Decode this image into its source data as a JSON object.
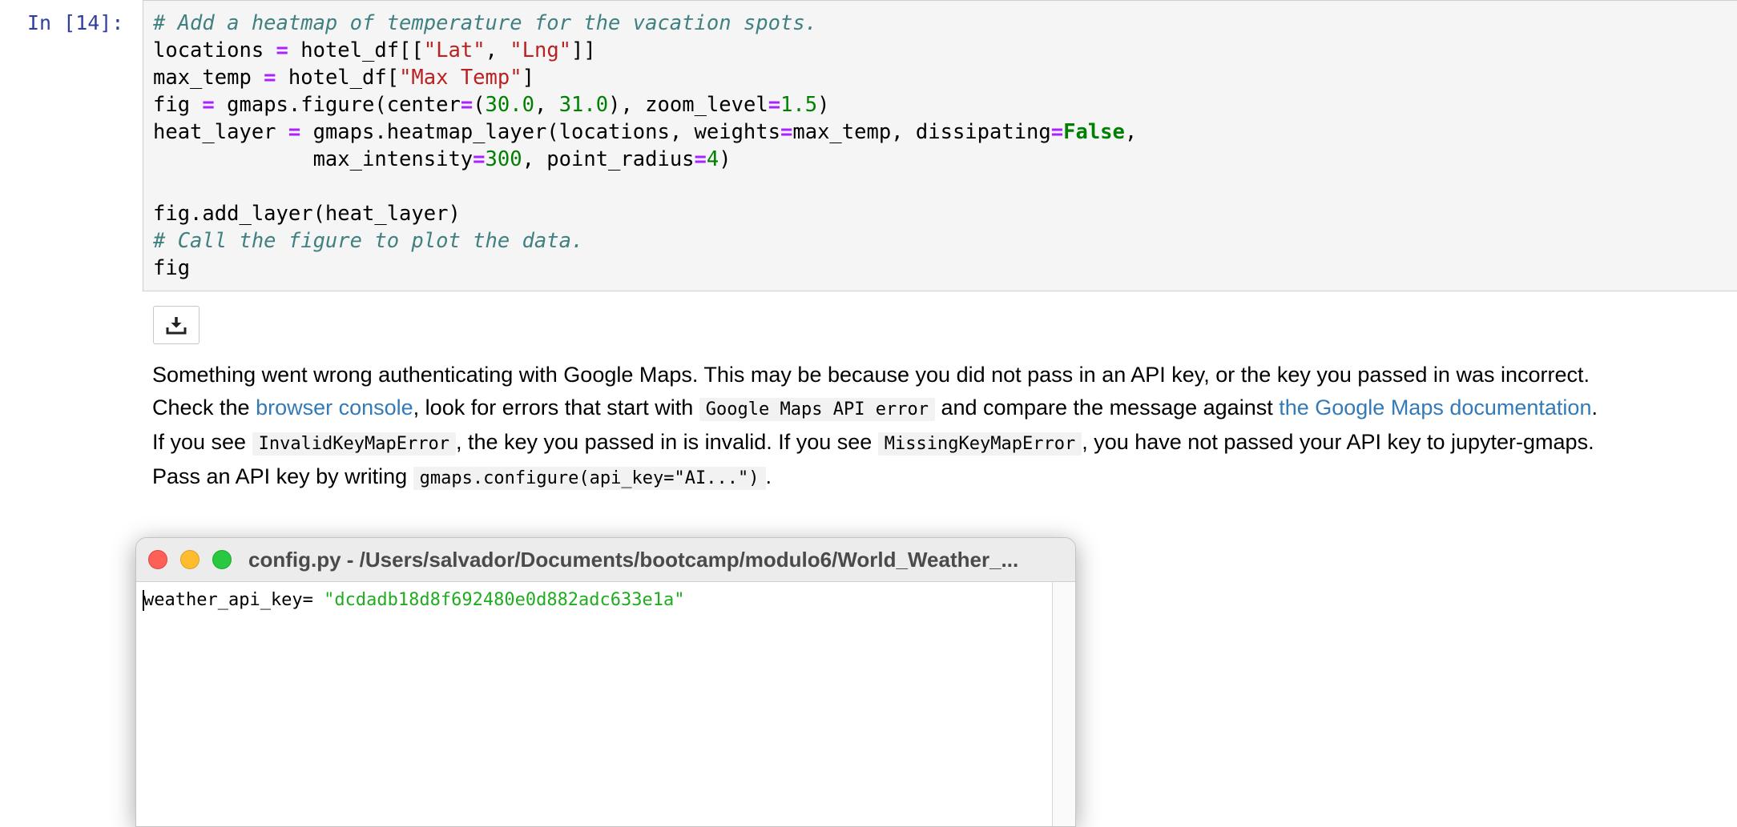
{
  "cell": {
    "prompt": "In [14]:",
    "code": [
      [
        {
          "t": "# Add a heatmap of temperature for the vacation spots.",
          "c": "cm"
        }
      ],
      [
        {
          "t": "locations "
        },
        {
          "t": "=",
          "c": "op"
        },
        {
          "t": " hotel_df[["
        },
        {
          "t": "\"Lat\"",
          "c": "st"
        },
        {
          "t": ", "
        },
        {
          "t": "\"Lng\"",
          "c": "st"
        },
        {
          "t": "]]"
        }
      ],
      [
        {
          "t": "max_temp "
        },
        {
          "t": "=",
          "c": "op"
        },
        {
          "t": " hotel_df["
        },
        {
          "t": "\"Max Temp\"",
          "c": "st"
        },
        {
          "t": "]"
        }
      ],
      [
        {
          "t": "fig "
        },
        {
          "t": "=",
          "c": "op"
        },
        {
          "t": " gmaps.figure(center"
        },
        {
          "t": "=",
          "c": "op"
        },
        {
          "t": "("
        },
        {
          "t": "30.0",
          "c": "nu"
        },
        {
          "t": ", "
        },
        {
          "t": "31.0",
          "c": "nu"
        },
        {
          "t": "), zoom_level"
        },
        {
          "t": "=",
          "c": "op"
        },
        {
          "t": "1.5",
          "c": "nu"
        },
        {
          "t": ")"
        }
      ],
      [
        {
          "t": "heat_layer "
        },
        {
          "t": "=",
          "c": "op"
        },
        {
          "t": " gmaps.heatmap_layer(locations, weights"
        },
        {
          "t": "=",
          "c": "op"
        },
        {
          "t": "max_temp, dissipating"
        },
        {
          "t": "=",
          "c": "op"
        },
        {
          "t": "False",
          "c": "kw"
        },
        {
          "t": ","
        }
      ],
      [
        {
          "t": "             max_intensity"
        },
        {
          "t": "=",
          "c": "op"
        },
        {
          "t": "300",
          "c": "nu"
        },
        {
          "t": ", point_radius"
        },
        {
          "t": "=",
          "c": "op"
        },
        {
          "t": "4",
          "c": "nu"
        },
        {
          "t": ")"
        }
      ],
      [
        {
          "t": ""
        }
      ],
      [
        {
          "t": "fig.add_layer(heat_layer)"
        }
      ],
      [
        {
          "t": "# Call the figure to plot the data.",
          "c": "cm"
        }
      ],
      [
        {
          "t": "fig"
        }
      ]
    ]
  },
  "output": {
    "download_icon": "download-icon",
    "line1": "Something went wrong authenticating with Google Maps. This may be because you did not pass in an API key, or the key you passed in was incorrect.",
    "line2_pre": "Check the ",
    "line2_link1": "browser console",
    "line2_mid1": ", look for errors that start with ",
    "line2_code": "Google Maps API error",
    "line2_mid2": " and compare the message against ",
    "line2_link2": "the Google Maps documentation",
    "line2_end": ".",
    "line3_pre": "If you see ",
    "line3_code1": "InvalidKeyMapError",
    "line3_mid": ", the key you passed in is invalid. If you see ",
    "line3_code2": "MissingKeyMapError",
    "line3_end": ", you have not passed your API key to jupyter-gmaps.",
    "line4_pre": "Pass an API key by writing ",
    "line4_code": "gmaps.configure(api_key=\"AI...\")",
    "line4_end": "."
  },
  "editor": {
    "title": "config.py - /Users/salvador/Documents/bootcamp/modulo6/World_Weather_...",
    "var": "weather_api_key= ",
    "value": "\"dcdadb18d8f692480e0d882adc633e1a\"",
    "value_color": "#1fad1f"
  },
  "colors": {
    "prompt": "#303f9f",
    "link": "#337ab7",
    "string": "#ba2121",
    "operator": "#aa22ff",
    "number": "#008000",
    "comment": "#408080"
  }
}
